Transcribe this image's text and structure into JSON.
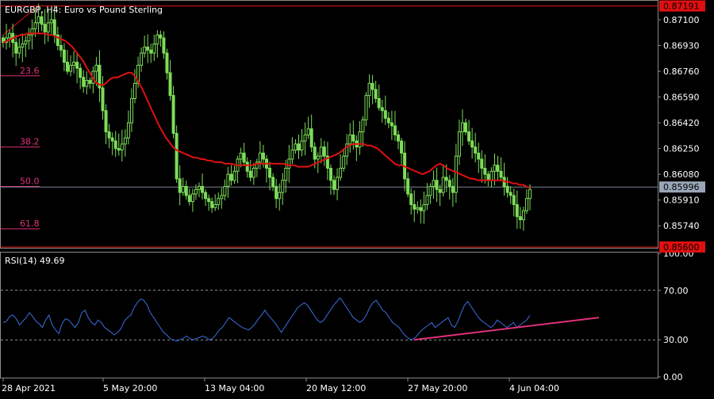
{
  "header": {
    "title": "EURGBP, H4:  Euro vs Pound Sterling",
    "rsi_label": "RSI(14) 49.69"
  },
  "colors": {
    "background": "#000000",
    "candles": "#7ddc5a",
    "moving_average": "#e01010",
    "fib_levels": "#e0307a",
    "rsi_line": "#3a6fe0",
    "trendline": "#e0307a",
    "price_tag_red": "#e01010",
    "price_tag_current": "#9aa6b8",
    "axis_text": "#ffffff",
    "grid": "#8a8a8a"
  },
  "chart_data": [
    {
      "type": "candlestick",
      "symbol": "EURGBP",
      "timeframe": "H4",
      "title": "Euro vs Pound Sterling",
      "ylim": [
        0.856,
        0.8722
      ],
      "y_ticks": [
        "0.87100",
        "0.86930",
        "0.86760",
        "0.86590",
        "0.86420",
        "0.86250",
        "0.86080",
        "0.85910",
        "0.85740"
      ],
      "x_ticks": [
        "28 Apr 2021",
        "5 May 20:00",
        "13 May 04:00",
        "20 May 12:00",
        "27 May 20:00",
        "4 Jun 04:00"
      ],
      "price_tags": {
        "high": "0.87191",
        "current": "0.85996",
        "low": "0.85600"
      },
      "fibonacci_levels": [
        {
          "label": "23.6",
          "value": 0.8673
        },
        {
          "label": "38.2",
          "value": 0.8626
        },
        {
          "label": "50.0",
          "value": 0.86
        },
        {
          "label": "61.8",
          "value": 0.8572
        }
      ],
      "fib_range": {
        "high": 0.87191,
        "low": 0.856
      },
      "close_series": [
        0.8695,
        0.8698,
        0.8701,
        0.8695,
        0.8688,
        0.8692,
        0.8694,
        0.8696,
        0.87,
        0.8704,
        0.8708,
        0.8712,
        0.8707,
        0.8702,
        0.8708,
        0.871,
        0.87,
        0.8693,
        0.869,
        0.8682,
        0.8676,
        0.868,
        0.8682,
        0.8678,
        0.8672,
        0.8666,
        0.867,
        0.8668,
        0.8676,
        0.868,
        0.8665,
        0.865,
        0.8636,
        0.8632,
        0.863,
        0.8625,
        0.8624,
        0.8628,
        0.8632,
        0.8642,
        0.8658,
        0.8668,
        0.868,
        0.8688,
        0.8692,
        0.869,
        0.8688,
        0.8694,
        0.87,
        0.8698,
        0.8688,
        0.8675,
        0.866,
        0.8635,
        0.8605,
        0.8596,
        0.86,
        0.8594,
        0.859,
        0.8595,
        0.8598,
        0.86,
        0.8596,
        0.8592,
        0.859,
        0.8586,
        0.8588,
        0.8592,
        0.8594,
        0.86,
        0.8608,
        0.8604,
        0.861,
        0.8618,
        0.8622,
        0.8616,
        0.861,
        0.8606,
        0.8612,
        0.8616,
        0.8622,
        0.8618,
        0.8612,
        0.8606,
        0.86,
        0.8592,
        0.8596,
        0.8604,
        0.8612,
        0.8618,
        0.8624,
        0.8628,
        0.8624,
        0.863,
        0.8634,
        0.8638,
        0.8626,
        0.8618,
        0.862,
        0.8626,
        0.862,
        0.8612,
        0.8604,
        0.8598,
        0.8606,
        0.8612,
        0.862,
        0.8628,
        0.8634,
        0.863,
        0.8626,
        0.8636,
        0.8644,
        0.866,
        0.8668,
        0.8664,
        0.8658,
        0.8652,
        0.865,
        0.8645,
        0.8642,
        0.864,
        0.8634,
        0.863,
        0.8622,
        0.8605,
        0.8595,
        0.8588,
        0.8585,
        0.8586,
        0.8584,
        0.8588,
        0.8594,
        0.86,
        0.8604,
        0.8598,
        0.8596,
        0.8606,
        0.8604,
        0.86,
        0.8596,
        0.862,
        0.8636,
        0.8642,
        0.8636,
        0.863,
        0.8626,
        0.8622,
        0.8618,
        0.8612,
        0.8608,
        0.8604,
        0.861,
        0.8614,
        0.861,
        0.8606,
        0.86,
        0.8596,
        0.8594,
        0.8588,
        0.858,
        0.8578,
        0.8584,
        0.8592,
        0.8598
      ],
      "moving_average": [
        0.8695,
        0.8696,
        0.8697,
        0.8698,
        0.8699,
        0.87,
        0.87,
        0.8701,
        0.8701,
        0.8701,
        0.8701,
        0.8701,
        0.8701,
        0.87,
        0.87,
        0.8699,
        0.8698,
        0.8697,
        0.8696,
        0.8694,
        0.8692,
        0.8689,
        0.8686,
        0.8683,
        0.8679,
        0.8675,
        0.8671,
        0.8668,
        0.8667,
        0.8667,
        0.8669,
        0.8671,
        0.8672,
        0.8672,
        0.8673,
        0.8674,
        0.8675,
        0.8675,
        0.8673,
        0.8669,
        0.8665,
        0.866,
        0.8655,
        0.865,
        0.8645,
        0.864,
        0.8636,
        0.8632,
        0.8629,
        0.8626,
        0.8624,
        0.8623,
        0.8622,
        0.8621,
        0.862,
        0.8619,
        0.8619,
        0.8618,
        0.8618,
        0.8617,
        0.8617,
        0.8616,
        0.8616,
        0.8616,
        0.8615,
        0.8615,
        0.8615,
        0.8614,
        0.8614,
        0.8614,
        0.8614,
        0.8614,
        0.8614,
        0.8615,
        0.8615,
        0.8615,
        0.8615,
        0.8615,
        0.8615,
        0.8615,
        0.8615,
        0.8615,
        0.8614,
        0.8614,
        0.8614,
        0.8613,
        0.8613,
        0.8613,
        0.8613,
        0.8614,
        0.8615,
        0.8616,
        0.8617,
        0.8618,
        0.8619,
        0.862,
        0.8621,
        0.8622,
        0.8624,
        0.8626,
        0.8627,
        0.8628,
        0.8628,
        0.8628,
        0.8628,
        0.8627,
        0.8627,
        0.8626,
        0.8625,
        0.8623,
        0.8621,
        0.8619,
        0.8617,
        0.8615,
        0.8614,
        0.8614,
        0.8613,
        0.8612,
        0.8611,
        0.861,
        0.8609,
        0.8608,
        0.8609,
        0.861,
        0.8612,
        0.8614,
        0.8615,
        0.8614,
        0.8612,
        0.8611,
        0.861,
        0.8609,
        0.8608,
        0.8607,
        0.8606,
        0.8605,
        0.8605,
        0.8604,
        0.8604,
        0.8604,
        0.8604,
        0.8604,
        0.8604,
        0.8604,
        0.8604,
        0.8603,
        0.8603,
        0.8602,
        0.8602,
        0.8601,
        0.8601,
        0.86,
        0.8599
      ]
    },
    {
      "type": "line",
      "name": "RSI(14)",
      "ylim": [
        0,
        100
      ],
      "y_ticks": [
        "100.00",
        "70.00",
        "30.00",
        "0.00"
      ],
      "levels": [
        70,
        30
      ],
      "current_value": 49.69,
      "values": [
        44,
        45,
        49,
        50,
        47,
        42,
        45,
        48,
        52,
        49,
        45,
        43,
        40,
        46,
        50,
        42,
        38,
        35,
        43,
        47,
        46,
        43,
        40,
        44,
        52,
        54,
        48,
        44,
        42,
        46,
        44,
        40,
        38,
        36,
        34,
        36,
        39,
        45,
        48,
        50,
        56,
        60,
        63,
        62,
        58,
        52,
        48,
        44,
        40,
        36,
        34,
        31,
        30,
        29,
        30,
        31,
        33,
        31,
        30,
        31,
        32,
        33,
        32,
        30,
        31,
        34,
        38,
        40,
        44,
        48,
        46,
        44,
        42,
        40,
        39,
        38,
        40,
        43,
        47,
        50,
        54,
        50,
        47,
        44,
        40,
        36,
        40,
        44,
        48,
        52,
        56,
        58,
        60,
        58,
        54,
        50,
        46,
        44,
        46,
        50,
        54,
        58,
        61,
        64,
        60,
        56,
        52,
        48,
        46,
        44,
        46,
        50,
        56,
        60,
        62,
        58,
        54,
        52,
        48,
        44,
        42,
        40,
        36,
        33,
        31,
        30,
        32,
        35,
        38,
        40,
        42,
        44,
        40,
        42,
        44,
        46,
        48,
        42,
        40,
        45,
        52,
        58,
        61,
        57,
        53,
        49,
        46,
        44,
        42,
        40,
        42,
        46,
        44,
        42,
        40,
        42,
        44,
        40,
        42,
        44,
        46,
        49.69
      ],
      "trendline": {
        "from": [
          0,
          30
        ],
        "to": [
          1,
          48
        ]
      }
    }
  ]
}
